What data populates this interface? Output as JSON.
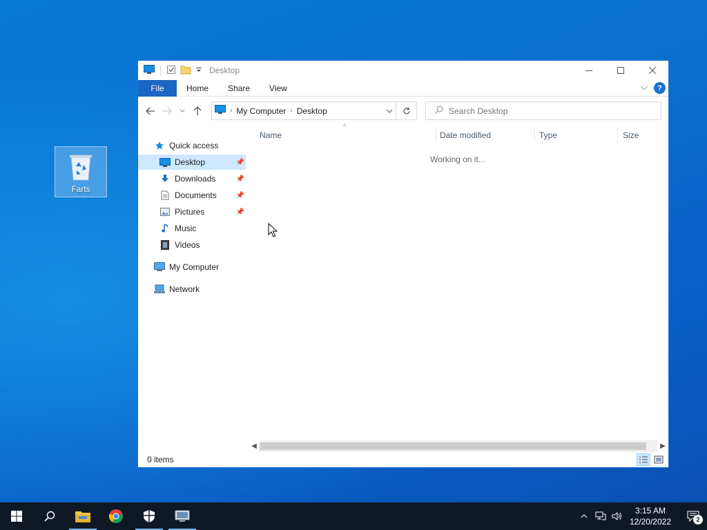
{
  "desktop": {
    "icon_label": "Farts"
  },
  "window": {
    "title": "Desktop",
    "ribbon_tabs": [
      "File",
      "Home",
      "Share",
      "View"
    ],
    "address": {
      "segments": [
        "My Computer",
        "Desktop"
      ]
    },
    "search": {
      "placeholder": "Search Desktop"
    },
    "sidebar": {
      "quick_access": "Quick access",
      "items": [
        {
          "label": "Desktop",
          "pinned": true,
          "selected": true,
          "icon": "desktop-icon"
        },
        {
          "label": "Downloads",
          "pinned": true,
          "icon": "download-arrow-icon"
        },
        {
          "label": "Documents",
          "pinned": true,
          "icon": "document-icon"
        },
        {
          "label": "Pictures",
          "pinned": true,
          "icon": "picture-icon"
        },
        {
          "label": "Music",
          "icon": "music-note-icon"
        },
        {
          "label": "Videos",
          "icon": "film-icon"
        }
      ],
      "my_computer": "My Computer",
      "network": "Network"
    },
    "columns": [
      "Name",
      "Date modified",
      "Type",
      "Size"
    ],
    "status_message": "Working on it...",
    "status_bar": {
      "item_count": "0 items"
    }
  },
  "taskbar": {
    "apps": [
      "start",
      "search",
      "file-explorer",
      "chrome",
      "security",
      "remote-desktop"
    ],
    "clock": {
      "time": "3:15 AM",
      "date": "12/20/2022"
    },
    "notification_count": "2"
  },
  "colors": {
    "accent": "#1a66c2",
    "selection": "#cde8ff",
    "taskbar": "#101826"
  }
}
